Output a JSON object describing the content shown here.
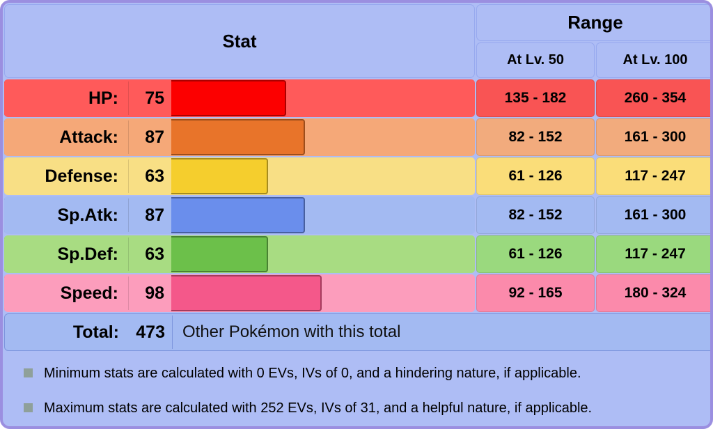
{
  "header": {
    "stat_label": "Stat",
    "range_label": "Range",
    "lv50_label": "At Lv. 50",
    "lv100_label": "At Lv. 100"
  },
  "max_bar_stat": 255,
  "stats": [
    {
      "name": "HP:",
      "value": "75",
      "bar_value": 75,
      "lv50": "135 - 182",
      "lv100": "260 - 354",
      "fill_color": "#fc0000",
      "track_color": "#ff5a5a",
      "range_color": "#f95454"
    },
    {
      "name": "Attack:",
      "value": "87",
      "bar_value": 87,
      "lv50": "82 - 152",
      "lv100": "161 - 300",
      "fill_color": "#e8742a",
      "track_color": "#f5a878",
      "range_color": "#f2ab7d"
    },
    {
      "name": "Defense:",
      "value": "63",
      "bar_value": 63,
      "lv50": "61 - 126",
      "lv100": "117 - 247",
      "fill_color": "#f5ce2d",
      "track_color": "#f8df85",
      "range_color": "#fadd79"
    },
    {
      "name": "Sp.Atk:",
      "value": "87",
      "bar_value": 87,
      "lv50": "82 - 152",
      "lv100": "161 - 300",
      "fill_color": "#6a8eec",
      "track_color": "#a3baf2",
      "range_color": "#a3baf2"
    },
    {
      "name": "Sp.Def:",
      "value": "63",
      "bar_value": 63,
      "lv50": "61 - 126",
      "lv100": "117 - 247",
      "fill_color": "#6cc04a",
      "track_color": "#a8dc82",
      "range_color": "#9ad97e"
    },
    {
      "name": "Speed:",
      "value": "98",
      "bar_value": 98,
      "lv50": "92 - 165",
      "lv100": "180 - 324",
      "fill_color": "#f4588a",
      "track_color": "#fc9dbc",
      "range_color": "#fb8aab"
    }
  ],
  "total": {
    "label": "Total:",
    "value": "473",
    "link_text": "Other Pokémon with this total"
  },
  "notes": [
    "Minimum stats are calculated with 0 EVs, IVs of 0, and a hindering nature, if applicable.",
    "Maximum stats are calculated with 252 EVs, IVs of 31, and a helpful nature, if applicable."
  ]
}
